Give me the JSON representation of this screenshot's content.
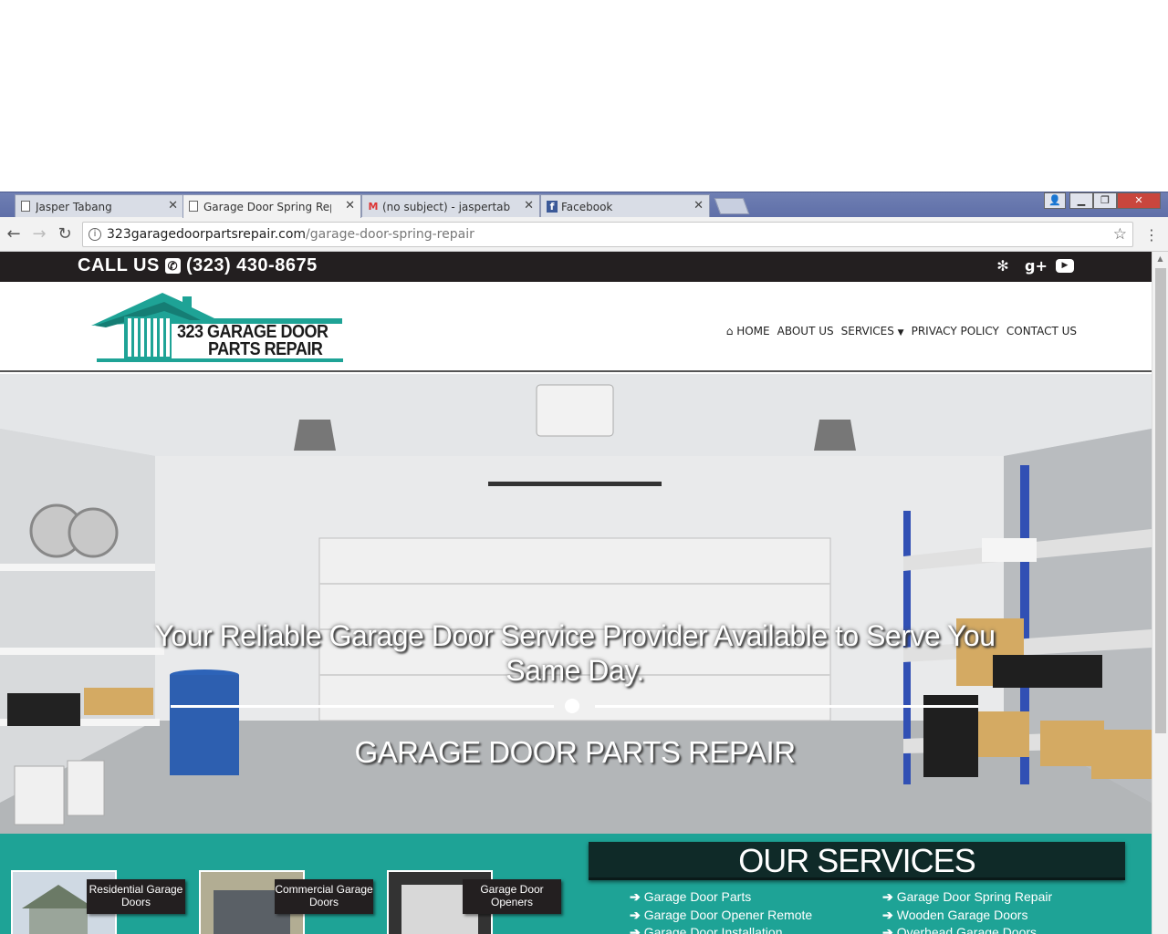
{
  "browser": {
    "tabs": [
      {
        "label": "Jasper Tabang",
        "icon": "doc-icon"
      },
      {
        "label": "Garage Door Spring Repa",
        "icon": "doc-icon"
      },
      {
        "label": "(no subject) - jaspertaba",
        "icon": "gmail-icon"
      },
      {
        "label": "Facebook",
        "icon": "facebook-icon"
      }
    ],
    "url_host": "323garagedoorpartsrepair.com",
    "url_path": "/garage-door-spring-repair"
  },
  "site": {
    "call_label": "CALL US",
    "phone": "(323) 430-8675",
    "logo_line1": "323 GARAGE DOOR",
    "logo_line2": "PARTS REPAIR",
    "nav": {
      "home": "HOME",
      "about": "ABOUT US",
      "services": "SERVICES",
      "privacy": "PRIVACY POLICY",
      "contact": "CONTACT US"
    },
    "hero_tagline": "Your Reliable Garage Door Service Provider Available to Serve You Same Day.",
    "hero_subtitle": "GARAGE DOOR PARTS REPAIR",
    "cards": [
      {
        "label": "Residential Garage Doors"
      },
      {
        "label": "Commercial Garage Doors"
      },
      {
        "label": "Garage Door Openers"
      }
    ],
    "our_services_title": "OUR SERVICES",
    "services_left": [
      "Garage Door Parts",
      "Garage Door Opener Remote",
      "Garage Door Installation"
    ],
    "services_right": [
      "Garage Door Spring Repair",
      "Wooden Garage Doors",
      "Overhead Garage Doors"
    ],
    "colors": {
      "teal": "#1ea396",
      "dark": "#231f20"
    }
  }
}
